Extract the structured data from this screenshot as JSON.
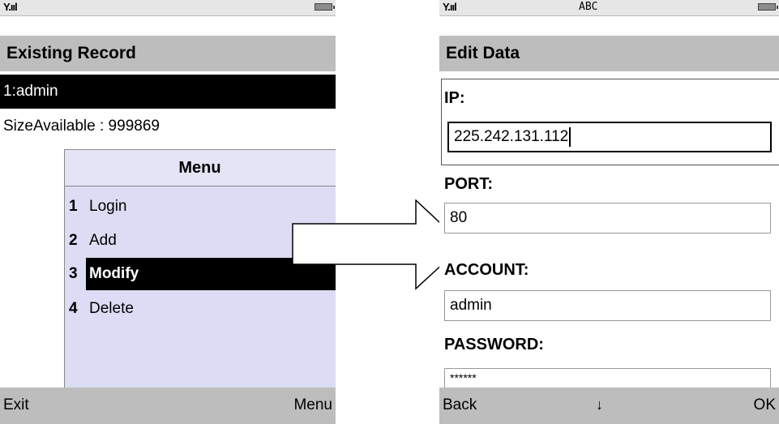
{
  "left_screen": {
    "status": {
      "signal": "Y.ııl"
    },
    "title": "Existing Record",
    "record_item": "1:admin",
    "size_text": "SizeAvailable : 999869",
    "menu": {
      "header": "Menu",
      "items": [
        {
          "num": "1",
          "label": "Login"
        },
        {
          "num": "2",
          "label": "Add"
        },
        {
          "num": "3",
          "label": "Modify"
        },
        {
          "num": "4",
          "label": "Delete"
        }
      ],
      "selected": "Modify"
    },
    "softkeys": {
      "left": "Exit",
      "right": "Menu"
    }
  },
  "right_screen": {
    "status": {
      "signal": "Y.ııl",
      "mode": "ABC"
    },
    "title": "Edit Data",
    "fields": [
      {
        "label": "IP:",
        "value": "225.242.131.112"
      },
      {
        "label": "PORT:",
        "value": "80"
      },
      {
        "label": "ACCOUNT:",
        "value": "admin"
      },
      {
        "label": "PASSWORD:",
        "value": "******"
      }
    ],
    "softkeys": {
      "left": "Back",
      "center_icon": "down-arrow-icon",
      "center": "↓",
      "right": "OK"
    }
  }
}
